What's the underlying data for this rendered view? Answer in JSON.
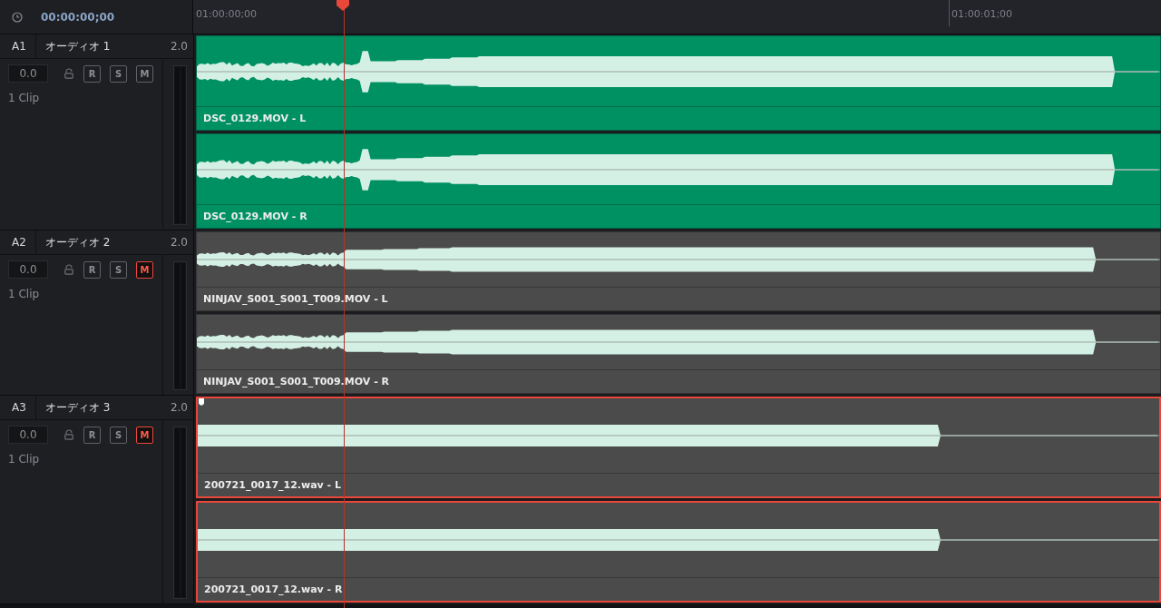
{
  "timecode": "00:00:00;00",
  "ruler": {
    "labels": [
      "01:00:00;00",
      "01:00:01;00"
    ]
  },
  "playhead": {
    "level": 0.155
  },
  "tracks": [
    {
      "id": "A1",
      "name": "オーディオ 1",
      "channels": "2.0",
      "volume": "0.0",
      "clip_count": "1 Clip",
      "buttons": [
        {
          "label": "R",
          "on": false
        },
        {
          "label": "S",
          "on": false
        },
        {
          "label": "M",
          "on": false
        }
      ],
      "clips": [
        {
          "label": "DSC_0129.MOV - L",
          "color": "#009162",
          "selected": false,
          "kind": "burst"
        },
        {
          "label": "DSC_0129.MOV - R",
          "color": "#009162",
          "selected": false,
          "kind": "burst"
        }
      ]
    },
    {
      "id": "A2",
      "name": "オーディオ 2",
      "channels": "2.0",
      "volume": "0.0",
      "clip_count": "1 Clip",
      "buttons": [
        {
          "label": "R",
          "on": false
        },
        {
          "label": "S",
          "on": false
        },
        {
          "label": "M",
          "on": true
        }
      ],
      "clips": [
        {
          "label": "NINJAV_S001_S001_T009.MOV - L",
          "color": "#4b4b4b",
          "selected": false,
          "kind": "swell"
        },
        {
          "label": "NINJAV_S001_S001_T009.MOV - R",
          "color": "#4b4b4b",
          "selected": false,
          "kind": "swell"
        }
      ]
    },
    {
      "id": "A3",
      "name": "オーディオ 3",
      "channels": "2.0",
      "volume": "0.0",
      "clip_count": "1 Clip",
      "buttons": [
        {
          "label": "R",
          "on": false
        },
        {
          "label": "S",
          "on": false
        },
        {
          "label": "M",
          "on": true
        }
      ],
      "clips": [
        {
          "label": "200721_0017_12.wav - L",
          "color": "#4b4b4b",
          "selected": true,
          "kind": "tone"
        },
        {
          "label": "200721_0017_12.wav - R",
          "color": "#4b4b4b",
          "selected": true,
          "kind": "tone"
        }
      ]
    }
  ]
}
